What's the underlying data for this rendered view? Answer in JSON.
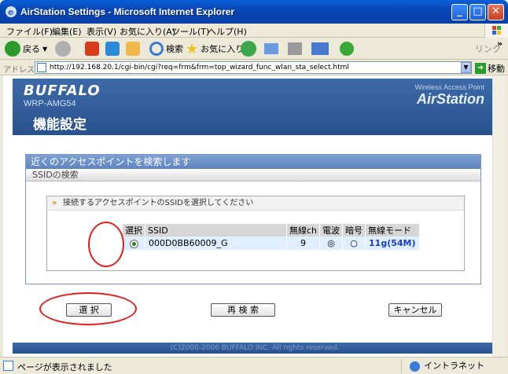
{
  "window": {
    "title": "AirStation Settings - Microsoft Internet Explorer",
    "minimize": "_",
    "maximize": "□",
    "close": "✕"
  },
  "menu": {
    "file": "ファイル(F)",
    "edit": "編集(E)",
    "view": "表示(V)",
    "favorites": "お気に入り(A)",
    "tools": "ツール(T)",
    "help": "ヘルプ(H)"
  },
  "toolbar": {
    "back": "戻る",
    "search": "検索",
    "favorites": "お気に入り",
    "links": "リンク",
    "more": "»"
  },
  "address": {
    "label": "アドレス(D)",
    "url": "http://192.168.20.1/cgi-bin/cgi?req=frm&frm=top_wizard_func_wlan_sta_select.html",
    "go": "移動"
  },
  "banner": {
    "brand": "BUFFALO",
    "model": "WRP-AMG54",
    "wap": "Wireless Access Point",
    "product": "AirStation",
    "page_heading": "機能設定"
  },
  "panel": {
    "title": "近くのアクセスポイントを検索します",
    "subtitle": "SSIDの検索",
    "instruction": "接続するアクセスポイントのSSIDを選択してください"
  },
  "table": {
    "headers": [
      "選択",
      "SSID",
      "無線ch",
      "電波",
      "暗号",
      "無線モード"
    ],
    "rows": [
      {
        "ssid": "000D0BB60009_G",
        "channel": "9",
        "signal": "◎",
        "encryption": "○",
        "mode": "11g(54M)"
      }
    ]
  },
  "buttons": {
    "select": "選 択",
    "rescan": "再 検 索",
    "cancel": "キャンセル"
  },
  "footer": "(C)2000-2006 BUFFALO INC. All rights reserved.",
  "status": {
    "text": "ページが表示されました",
    "zone": "イントラネット"
  },
  "colors": {
    "titlebar": "#0a5fd8",
    "banner": "#3d6aa8",
    "highlight_circle": "#e41e1e",
    "mode_text": "#1a3cc8"
  }
}
